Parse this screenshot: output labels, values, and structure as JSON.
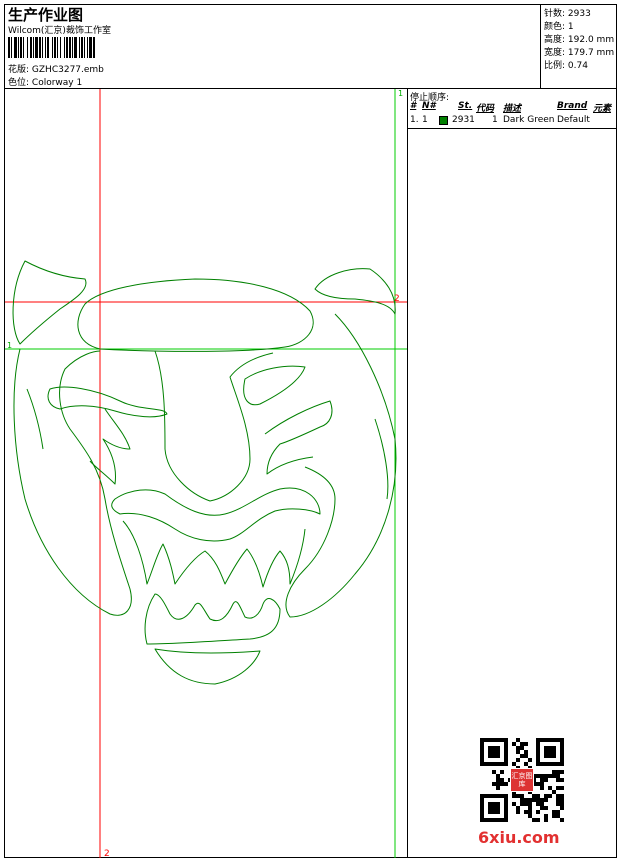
{
  "header": {
    "title": "生产作业图",
    "company": "Wilcom(汇京)裁饰工作室",
    "design_label": "花版:",
    "design_value": "GZHC3277.emb",
    "color_label": "色位:",
    "color_value": "Colorway 1"
  },
  "stats": [
    {
      "label": "针数:",
      "value": "2933"
    },
    {
      "label": "颜色:",
      "value": "1"
    },
    {
      "label": "高度:",
      "value": "192.0 mm"
    },
    {
      "label": "宽度:",
      "value": "179.7 mm"
    },
    {
      "label": "比例:",
      "value": "0.74"
    }
  ],
  "stop_sequence": {
    "label": "停止顺序:",
    "headers": [
      "#",
      "N#",
      "St.",
      "代码",
      "描述",
      "Brand",
      "元素"
    ],
    "rows": [
      {
        "index": "1.",
        "n": "1",
        "stitches": "2931",
        "code": "1",
        "description": "Dark Green",
        "brand": "Default",
        "color": "#008000"
      }
    ]
  },
  "guides": {
    "h1_label": "1",
    "h2_label": "2",
    "v1_label": "1",
    "v2_label": "2"
  },
  "colors": {
    "stitch": "#008000",
    "guide_red": "#ff0000",
    "guide_green": "#00cc00"
  },
  "watermark": {
    "text": "6xiu.com",
    "stamp": "汇京图库"
  }
}
